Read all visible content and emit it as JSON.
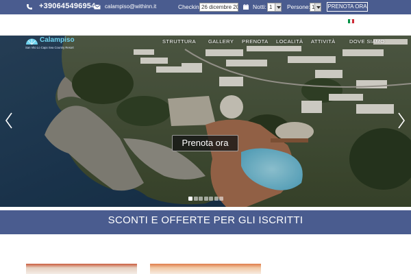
{
  "topbar": {
    "phone": "+390645496954",
    "email": "calampiso@withinn.it",
    "checkin_label": "Checkin:",
    "checkin_value": "26 dicembre 20",
    "notti_label": "Notti:",
    "notti_value": "1",
    "persone_label": "Persone:",
    "persone_value": "1",
    "book_label": "PRENOTA ORA"
  },
  "language": {
    "flag": "it-flag",
    "colors": [
      "#009246",
      "#ffffff",
      "#ce2b37"
    ]
  },
  "logo": {
    "name": "Calampiso",
    "tagline": "San Vito Lo Capo Sea Country Resort"
  },
  "nav": {
    "items": [
      "STRUTTURA",
      "GALLERY",
      "PRENOTA",
      "LOCALITÀ",
      "ATTIVITÀ",
      "DOVE SIAMO"
    ]
  },
  "hero": {
    "cta_label": "Prenota ora",
    "slides_total": 7,
    "active_slide": 1,
    "prev_icon": "chevron-left-icon",
    "next_icon": "chevron-right-icon"
  },
  "band": {
    "title": "SCONTI E OFFERTE PER GLI ISCRITTI"
  },
  "colors": {
    "brand": "#4a5c8f",
    "logo": "#6fd3ef"
  }
}
